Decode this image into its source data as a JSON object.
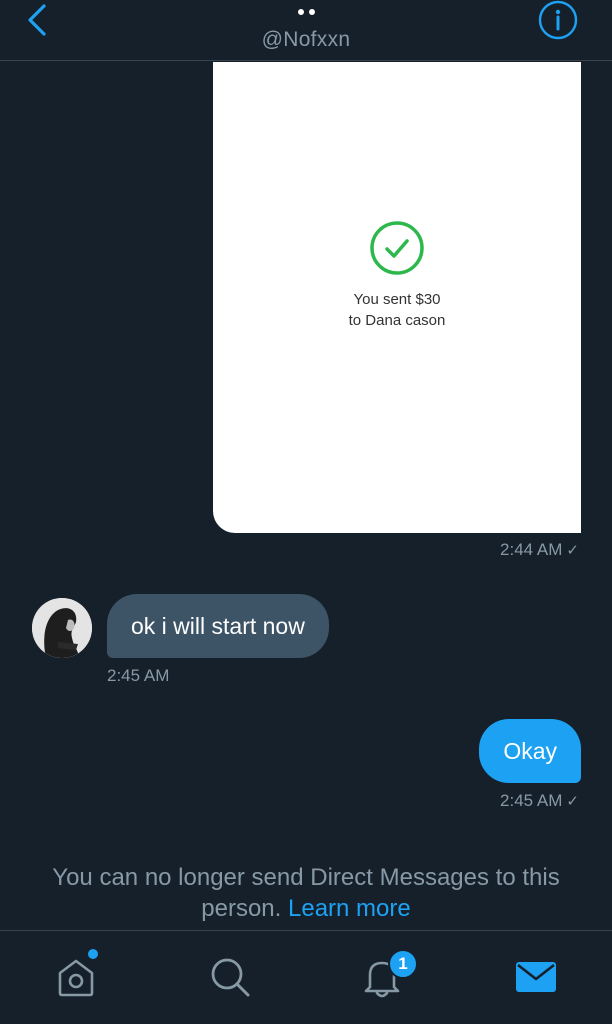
{
  "header": {
    "handle": "@Nofxxn"
  },
  "attachment": {
    "line1": "You sent $30",
    "line2": "to Dana cason",
    "timestamp": "2:44 AM",
    "status_mark": "✓"
  },
  "incoming": {
    "text": "ok i will start now",
    "timestamp": "2:45 AM"
  },
  "outgoing": {
    "text": "Okay",
    "timestamp": "2:45 AM",
    "status_mark": "✓"
  },
  "notice": {
    "text": "You can no longer send Direct Messages to this person.",
    "link": "Learn more"
  },
  "tabbar": {
    "notifications_badge": "1",
    "items": [
      "home-icon",
      "search-icon",
      "bell-icon",
      "mail-icon"
    ]
  },
  "colors": {
    "background": "#15202b",
    "accent": "#1da1f2",
    "incoming_bubble": "#3d5466",
    "muted_text": "#8899a6",
    "success": "#2db84b"
  }
}
